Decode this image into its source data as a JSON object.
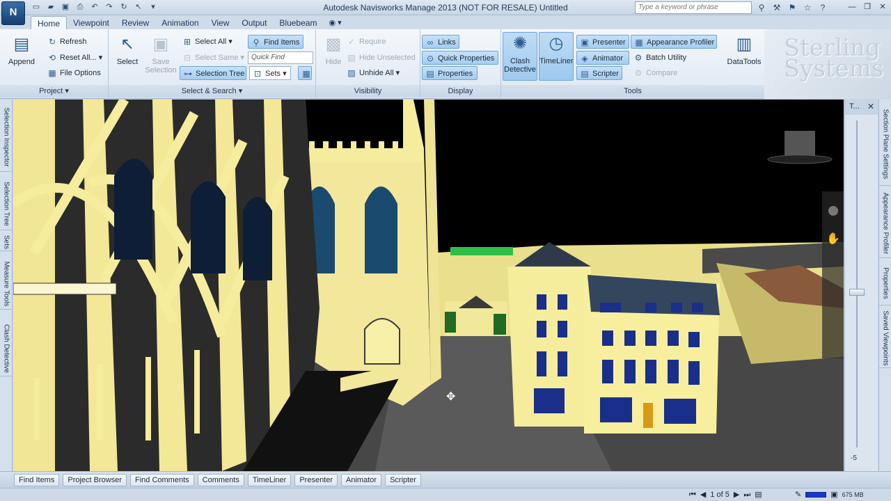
{
  "app": {
    "title": "Autodesk Navisworks Manage 2013 (NOT FOR RESALE)    Untitled",
    "app_button": "N",
    "search_placeholder": "Type a keyword or phrase"
  },
  "tabs": [
    "Home",
    "Viewpoint",
    "Review",
    "Animation",
    "View",
    "Output",
    "Bluebeam"
  ],
  "tab_extra": "◉ ▾",
  "ribbon": {
    "project": {
      "label": "Project",
      "append": "Append",
      "refresh": "Refresh",
      "reset_all": "Reset All...",
      "file_options": "File Options"
    },
    "select_search": {
      "label": "Select & Search",
      "select": "Select",
      "save_selection": "Save Selection",
      "select_all": "Select All",
      "select_same": "Select Same",
      "selection_tree": "Selection Tree",
      "find_items": "Find Items",
      "quick_find_placeholder": "Quick Find",
      "sets": "Sets"
    },
    "visibility": {
      "label": "Visibility",
      "hide": "Hide",
      "require": "Require",
      "hide_unselected": "Hide Unselected",
      "unhide_all": "Unhide All"
    },
    "display": {
      "label": "Display",
      "links": "Links",
      "quick_properties": "Quick Properties",
      "properties": "Properties"
    },
    "tools": {
      "label": "Tools",
      "clash_detective": "Clash Detective",
      "timeliner": "TimeLiner",
      "presenter": "Presenter",
      "animator": "Animator",
      "scripter": "Scripter",
      "appearance_profiler": "Appearance Profiler",
      "batch_utility": "Batch Utility",
      "compare": "Compare",
      "datatools": "DataTools"
    },
    "logo": "Sterling\nSystems"
  },
  "left_dock": [
    "Selection Inspector",
    "Selection Tree",
    "Sets",
    "Measure Tools",
    "Clash Detective"
  ],
  "right_dock": [
    "Section Plane Settings",
    "Appearance Profiler",
    "Properties",
    "Saved Viewpoints"
  ],
  "right_panel": {
    "title": "T...",
    "close": "✕",
    "value": "-5"
  },
  "bottom_tabs": [
    "Find Items",
    "Project Browser",
    "Find Comments",
    "Comments",
    "TimeLiner",
    "Presenter",
    "Animator",
    "Scripter"
  ],
  "status": {
    "page": "1 of 5",
    "memory": "675 MB"
  },
  "icons": {
    "append": "append-icon",
    "select": "cursor-icon",
    "clash": "clash-icon",
    "datatools": "database-icon"
  },
  "colors": {
    "ribbon_bg": "#e7eef6",
    "building": "#f5ec9c",
    "window_blue": "#1a2f8a",
    "viewport_bg": "#000000"
  }
}
